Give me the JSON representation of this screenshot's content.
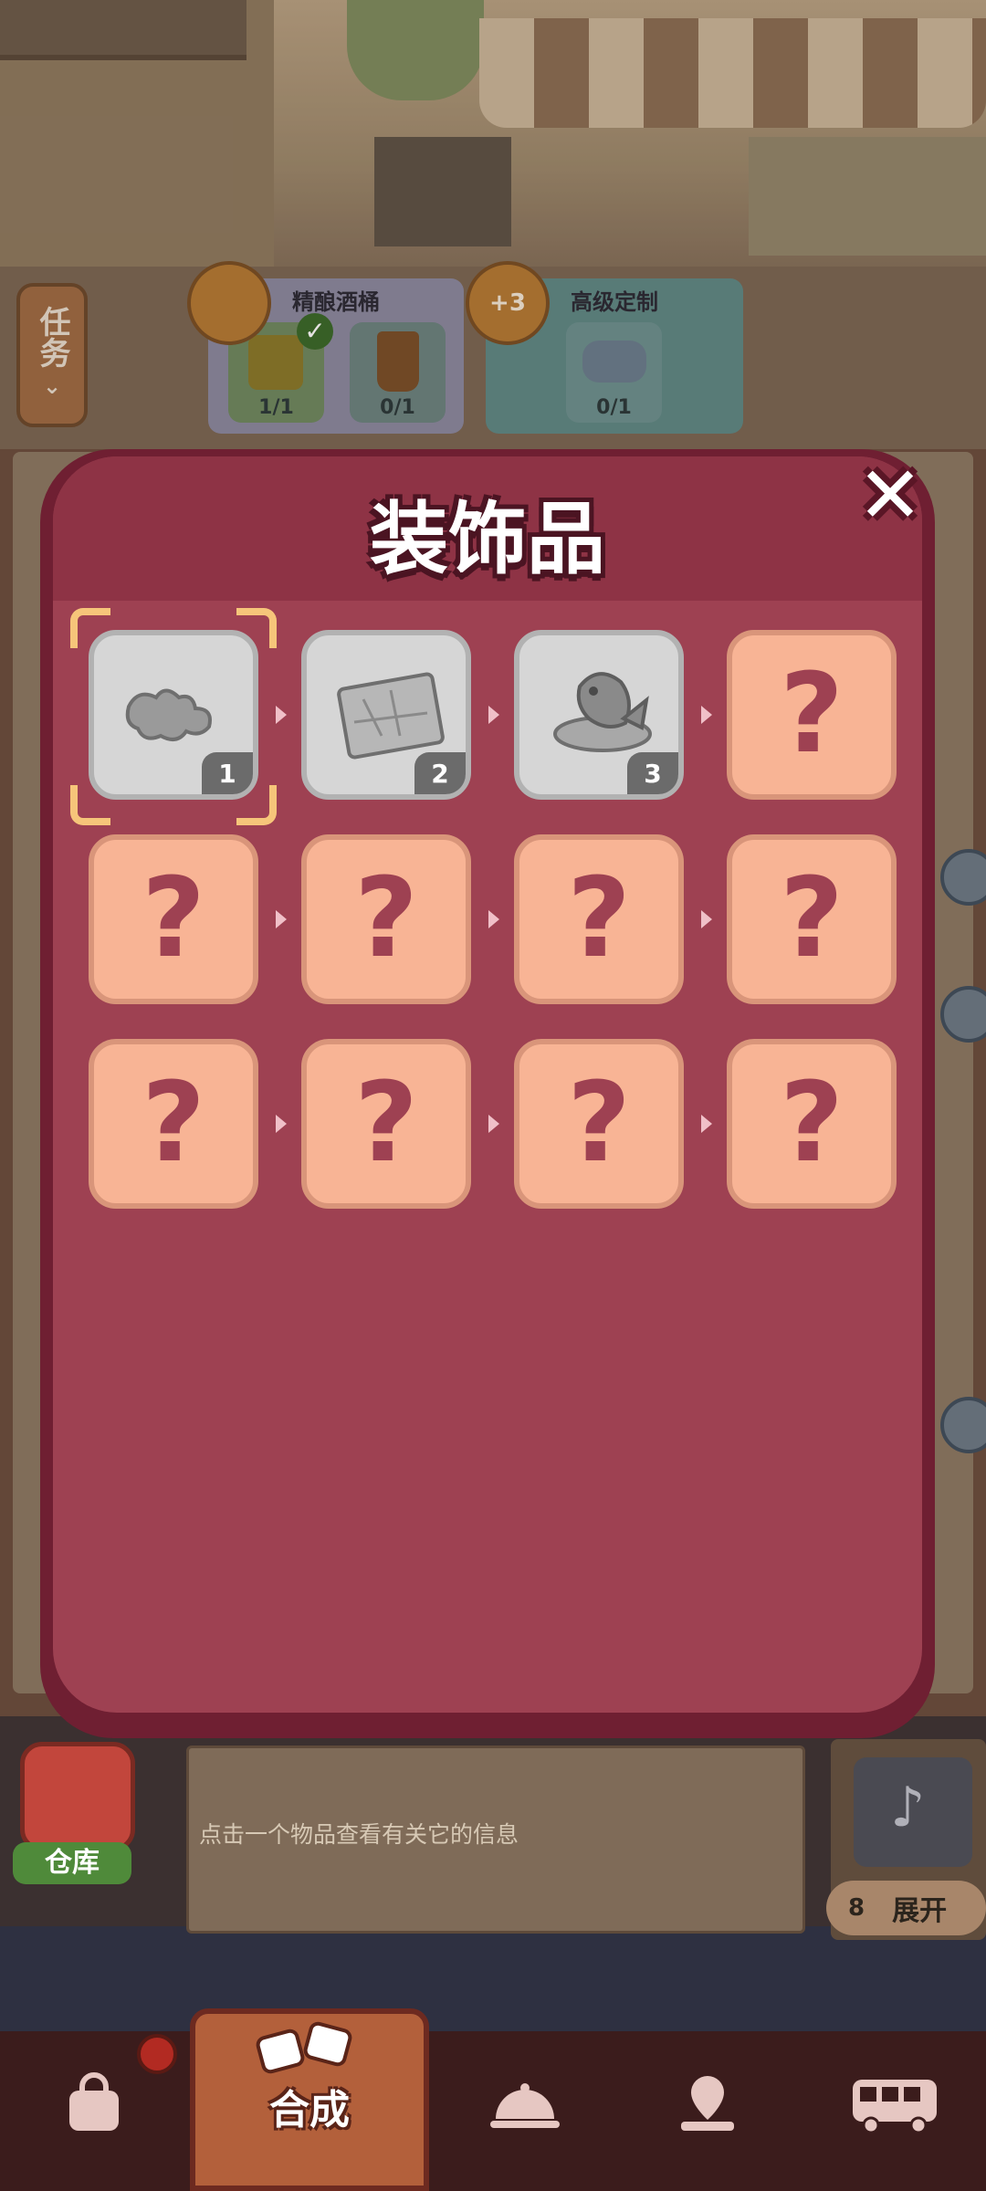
{
  "hud": {
    "task_button_label": "任务",
    "task_cards": [
      {
        "title": "精酿酒桶",
        "slots": [
          {
            "count": "1/1",
            "done": true
          },
          {
            "count": "0/1",
            "done": false
          }
        ]
      },
      {
        "title": "高级定制",
        "badge": "+3",
        "slots": [
          {
            "count": "0/1",
            "done": false
          }
        ]
      }
    ]
  },
  "modal": {
    "title": "装饰品",
    "close_label": "✕",
    "rows": [
      [
        {
          "state": "known",
          "level": "1",
          "icon": "puzzle-pieces-icon",
          "selected": true
        },
        {
          "state": "known",
          "level": "2",
          "icon": "puzzle-board-icon",
          "selected": false
        },
        {
          "state": "known",
          "level": "3",
          "icon": "koi-fish-icon",
          "selected": false
        },
        {
          "state": "locked",
          "label": "?"
        }
      ],
      [
        {
          "state": "locked",
          "label": "?"
        },
        {
          "state": "locked",
          "label": "?"
        },
        {
          "state": "locked",
          "label": "?"
        },
        {
          "state": "locked",
          "label": "?"
        }
      ],
      [
        {
          "state": "locked",
          "label": "?"
        },
        {
          "state": "locked",
          "label": "?"
        },
        {
          "state": "locked",
          "label": "?"
        },
        {
          "state": "locked",
          "label": "?"
        }
      ]
    ]
  },
  "info_bar": {
    "storage_label": "仓库",
    "hint_text": "点击一个物品查看有关它的信息",
    "expand_count": "8",
    "expand_label": "展开"
  },
  "bottom_nav": {
    "items": [
      {
        "name": "shop-bag",
        "icon": "bag-icon"
      },
      {
        "name": "merge",
        "icon": "merge-icon",
        "label": "合成",
        "active": true
      },
      {
        "name": "restaurant",
        "icon": "cloche-icon"
      },
      {
        "name": "map",
        "icon": "map-pin-icon"
      },
      {
        "name": "bus",
        "icon": "bus-icon"
      }
    ]
  },
  "colors": {
    "modal_frame": "#6f1f32",
    "modal_body": "#9e4152",
    "tile_locked": "#f8b495",
    "tile_known": "#d6d6d6",
    "selection_bracket": "#f6c57a"
  }
}
